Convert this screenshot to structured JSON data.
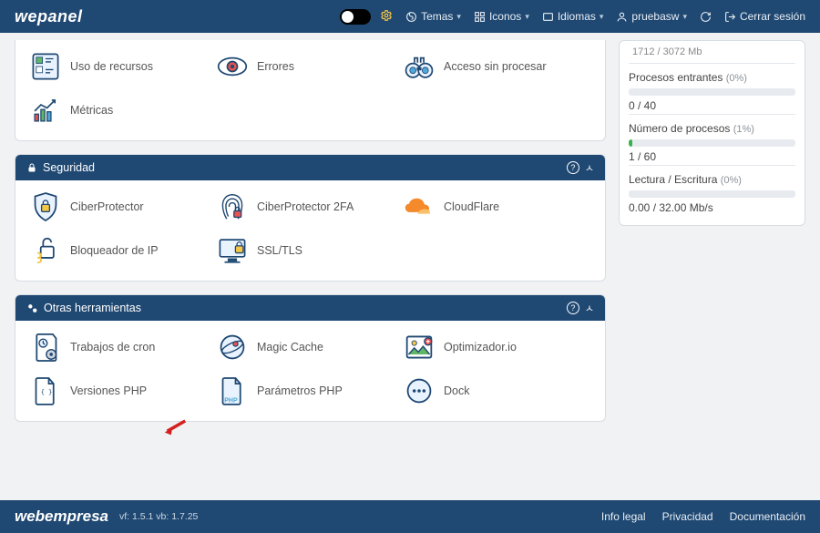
{
  "brand": "wepanel",
  "topnav": {
    "themes": "Temas",
    "icons": "Iconos",
    "languages": "Idiomas",
    "user": "pruebasw",
    "logout": "Cerrar sesión"
  },
  "panels": {
    "metrics": {
      "items": {
        "usage": "Uso de recursos",
        "errors": "Errores",
        "raw": "Acceso sin procesar",
        "metrics": "Métricas"
      }
    },
    "security": {
      "title": "Seguridad",
      "items": {
        "ciber": "CiberProtector",
        "ciber2fa": "CiberProtector 2FA",
        "cloud": "CloudFlare",
        "ipblock": "Bloqueador de IP",
        "ssl": "SSL/TLS"
      }
    },
    "tools": {
      "title": "Otras herramientas",
      "items": {
        "cron": "Trabajos de cron",
        "magic": "Magic Cache",
        "opt": "Optimizador.io",
        "phpver": "Versiones PHP",
        "phpparam": "Parámetros PHP",
        "dock": "Dock"
      }
    }
  },
  "stats": {
    "truncated": "1712 / 3072 Mb",
    "inproc": {
      "title": "Procesos entrantes",
      "pct": "(0%)",
      "fillpct": 0,
      "val": "0 / 40"
    },
    "numproc": {
      "title": "Número de procesos",
      "pct": "(1%)",
      "fillpct": 2,
      "val": "1 / 60"
    },
    "rw": {
      "title": "Lectura / Escritura",
      "pct": "(0%)",
      "fillpct": 0,
      "val": "0.00 / 32.00 Mb/s"
    }
  },
  "footer": {
    "brand": "webempresa",
    "version": "vf: 1.5.1 vb: 1.7.25",
    "links": {
      "legal": "Info legal",
      "privacy": "Privacidad",
      "docs": "Documentación"
    }
  }
}
